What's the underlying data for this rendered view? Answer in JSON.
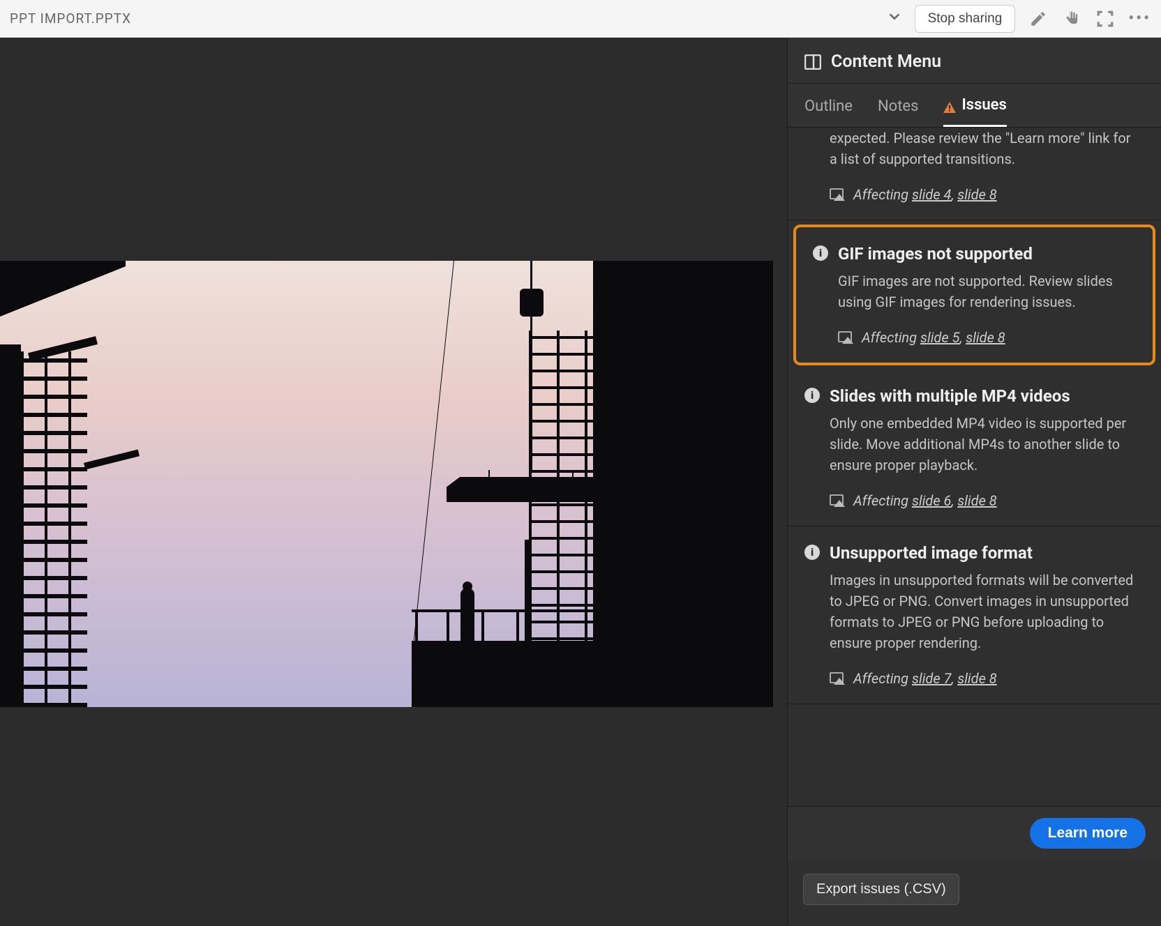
{
  "top": {
    "filename": "PPT IMPORT.PPTX",
    "stop_sharing": "Stop sharing"
  },
  "sidebar": {
    "title": "Content Menu",
    "tabs": {
      "outline": "Outline",
      "notes": "Notes",
      "issues": "Issues"
    },
    "partial_issue": {
      "desc_fragment": "expected. Please review the \"Learn more\" link for a list of supported transitions.",
      "affecting_prefix": "Affecting",
      "slide_a": "slide 4",
      "slide_b": "slide 8"
    },
    "issues": [
      {
        "title": "GIF images not supported",
        "desc": "GIF images are not supported. Review slides using GIF images for rendering issues.",
        "affecting_prefix": "Affecting",
        "slide_a": "slide 5",
        "slide_b": "slide 8",
        "highlighted": true
      },
      {
        "title": "Slides with multiple MP4 videos",
        "desc": "Only one embedded MP4 video is supported per slide. Move additional MP4s to another slide to ensure proper playback.",
        "affecting_prefix": "Affecting",
        "slide_a": "slide 6",
        "slide_b": "slide 8"
      },
      {
        "title": "Unsupported image format",
        "desc": "Images in unsupported formats will be converted to JPEG or PNG. Convert images in unsupported formats to JPEG or PNG before uploading to ensure proper rendering.",
        "affecting_prefix": "Affecting",
        "slide_a": "slide 7",
        "slide_b": "slide 8"
      }
    ],
    "learn_more": "Learn more",
    "export": "Export issues (.CSV)"
  }
}
